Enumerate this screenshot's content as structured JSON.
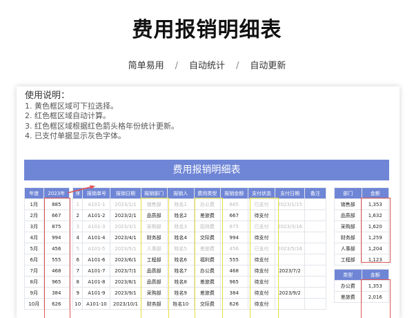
{
  "header": {
    "title": "费用报销明细表",
    "tags": [
      "简单易用",
      "自动统计",
      "自动更新"
    ],
    "separator": "/"
  },
  "instructions": {
    "title": "使用说明：",
    "lines": [
      "1. 黄色框区域可下拉选择。",
      "2. 红色框区域自动计算。",
      "3. 红色框区域根据红色箭头格年份统计更新。",
      "4. 已支付单据显示灰色字体。"
    ]
  },
  "sheet": {
    "banner": "费用报销明细表",
    "month_table": {
      "headers": [
        "年度",
        "2023年"
      ],
      "rows": [
        [
          "1月",
          "885"
        ],
        [
          "2月",
          "667"
        ],
        [
          "3月",
          "875"
        ],
        [
          "4月",
          "994"
        ],
        [
          "5月",
          "456"
        ],
        [
          "6月",
          "555"
        ],
        [
          "7月",
          "468"
        ],
        [
          "8月",
          "965"
        ],
        [
          "9月",
          "384"
        ],
        [
          "10月",
          "626"
        ]
      ]
    },
    "detail_table": {
      "headers": [
        "序",
        "报销单号",
        "报销日期",
        "报销部门",
        "报销人",
        "费用类型",
        "报销金额",
        "支付状态",
        "支付日期",
        "备注"
      ],
      "rows": [
        [
          "1",
          "A101-1",
          "2023/1/1",
          "销售部",
          "姓名1",
          "办公费",
          "885",
          "已支付",
          "2023/1/15",
          ""
        ],
        [
          "2",
          "A101-2",
          "2023/2/1",
          "品质部",
          "姓名2",
          "差旅费",
          "667",
          "待支付",
          "",
          ""
        ],
        [
          "3",
          "A101-3",
          "2023/3/1",
          "采购部",
          "姓名3",
          "招待费",
          "875",
          "已支付",
          "2023/3/16",
          ""
        ],
        [
          "4",
          "A101-4",
          "2023/4/1",
          "财务部",
          "姓名4",
          "交际费",
          "994",
          "待支付",
          "",
          ""
        ],
        [
          "5",
          "A101-5",
          "2023/5/1",
          "人事部",
          "姓名5",
          "差旅费",
          "456",
          "已支付",
          "2023/5/16",
          ""
        ],
        [
          "6",
          "A101-6",
          "2023/6/1",
          "工程部",
          "姓名6",
          "福利费",
          "555",
          "待支付",
          "",
          ""
        ],
        [
          "7",
          "A101-7",
          "2023/7/1",
          "品质部",
          "姓名7",
          "办公费",
          "468",
          "待支付",
          "2023/7/2",
          ""
        ],
        [
          "8",
          "A101-8",
          "2023/8/1",
          "品质部",
          "姓名8",
          "差旅费",
          "965",
          "待支付",
          "",
          ""
        ],
        [
          "9",
          "A101-9",
          "2023/9/1",
          "采购部",
          "姓名9",
          "差旅费",
          "384",
          "待支付",
          "2023/9/2",
          ""
        ],
        [
          "10",
          "A101-10",
          "2023/10/1",
          "财务部",
          "姓名10",
          "交际费",
          "626",
          "待支付",
          "",
          ""
        ]
      ],
      "paid_rows": [
        0,
        2,
        4
      ]
    },
    "dept_table": {
      "headers": [
        "部门",
        "金额"
      ],
      "rows": [
        [
          "销售部",
          "1,353"
        ],
        [
          "品质部",
          "1,632"
        ],
        [
          "采购部",
          "1,620"
        ],
        [
          "财务部",
          "1,259"
        ],
        [
          "人事部",
          "1,204"
        ],
        [
          "工程部",
          "1,123"
        ]
      ]
    },
    "type_table": {
      "headers": [
        "类型",
        "金额"
      ],
      "rows": [
        [
          "办公费",
          "1,353"
        ],
        [
          "差旅费",
          "2,016"
        ]
      ]
    }
  },
  "colors": {
    "header_blue": "#6f86d6",
    "yellow_box": "#e6df3c",
    "red_box": "#e05454",
    "paid_gray": "#b9b9b9"
  }
}
